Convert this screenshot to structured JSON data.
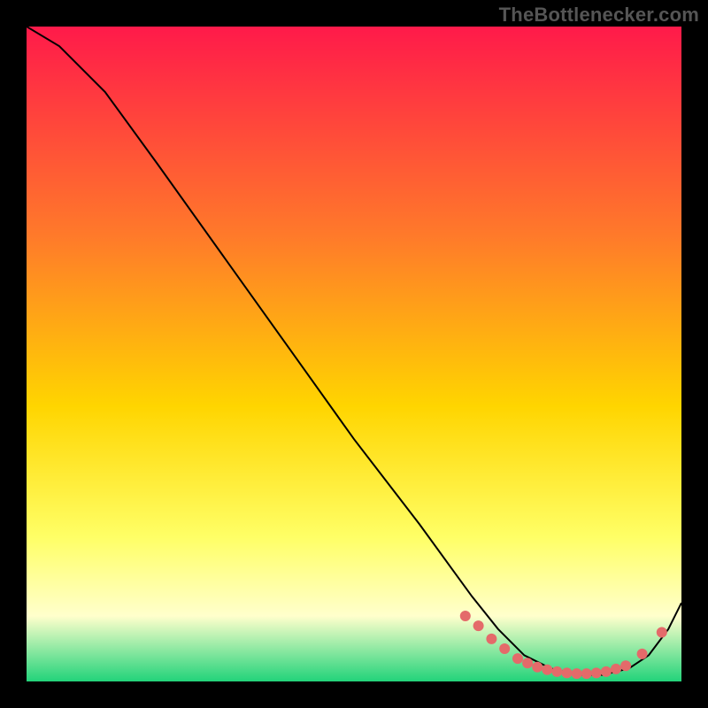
{
  "watermark": "TheBottleneсker.com",
  "colors": {
    "gradient_top": "#ff1a4a",
    "gradient_mid1": "#ff7a2a",
    "gradient_mid2": "#ffd500",
    "gradient_mid3": "#ffff66",
    "gradient_mid4": "#ffffcc",
    "gradient_bottom": "#22d37a",
    "curve": "#000000",
    "points": "#e46a6a",
    "bg": "#000000"
  },
  "chart_data": {
    "type": "line",
    "title": "",
    "xlabel": "",
    "ylabel": "",
    "xlim": [
      0,
      100
    ],
    "ylim": [
      0,
      100
    ],
    "grid": false,
    "legend": false,
    "series": [
      {
        "name": "curve",
        "x": [
          0,
          5,
          12,
          20,
          30,
          40,
          50,
          60,
          68,
          72,
          76,
          80,
          84,
          88,
          92,
          95,
          98,
          100
        ],
        "values": [
          100,
          97,
          90,
          79,
          65,
          51,
          37,
          24,
          13,
          8,
          4,
          2,
          1,
          1,
          2,
          4,
          8,
          12
        ]
      }
    ],
    "points": {
      "name": "dots",
      "x": [
        67,
        69,
        71,
        73,
        75,
        76.5,
        78,
        79.5,
        81,
        82.5,
        84,
        85.5,
        87,
        88.5,
        90,
        91.5,
        94,
        97
      ],
      "values": [
        10,
        8.5,
        6.5,
        5,
        3.5,
        2.8,
        2.2,
        1.8,
        1.5,
        1.3,
        1.2,
        1.2,
        1.3,
        1.5,
        1.9,
        2.4,
        4.2,
        7.5
      ]
    }
  }
}
